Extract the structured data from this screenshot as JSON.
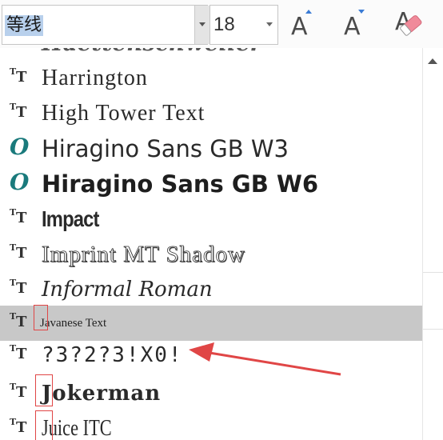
{
  "toolbar": {
    "font_name": "等线",
    "font_size": "18",
    "grow_font_glyph": "A",
    "shrink_font_glyph": "A",
    "clear_format_glyph": "A"
  },
  "font_list": {
    "partial_top_label": "Haettenschweiler",
    "items": [
      {
        "label": "Harrington",
        "icon": "truetype-icon"
      },
      {
        "label": "High Tower Text",
        "icon": "truetype-icon"
      },
      {
        "label": "Hiragino Sans GB W3",
        "icon": "opentype-icon"
      },
      {
        "label": "Hiragino Sans GB W6",
        "icon": "opentype-icon"
      },
      {
        "label": "Impact",
        "icon": "truetype-icon"
      },
      {
        "label": "Imprint MT Shadow",
        "icon": "truetype-icon"
      },
      {
        "label": "Informal Roman",
        "icon": "truetype-icon"
      },
      {
        "label": "Javanese Text",
        "icon": "truetype-icon"
      },
      {
        "label": "?3?2?3!X0!",
        "icon": "truetype-icon"
      },
      {
        "label": "Jokerman",
        "icon": "truetype-icon"
      },
      {
        "label": "Juice ITC",
        "icon": "truetype-icon"
      }
    ],
    "selected_index": 7
  },
  "colors": {
    "selection_highlight": "#c8c8c8",
    "input_highlight": "#b8d0ec",
    "annotation_red": "#e04646",
    "opentype_teal": "#1a7a7c",
    "accent_blue": "#3a7bd5"
  },
  "icons": [
    "chevron-down-icon",
    "grow-font-icon",
    "shrink-font-icon",
    "clear-formatting-icon",
    "truetype-icon",
    "opentype-icon",
    "scroll-up-arrow-icon",
    "annotation-arrow"
  ]
}
